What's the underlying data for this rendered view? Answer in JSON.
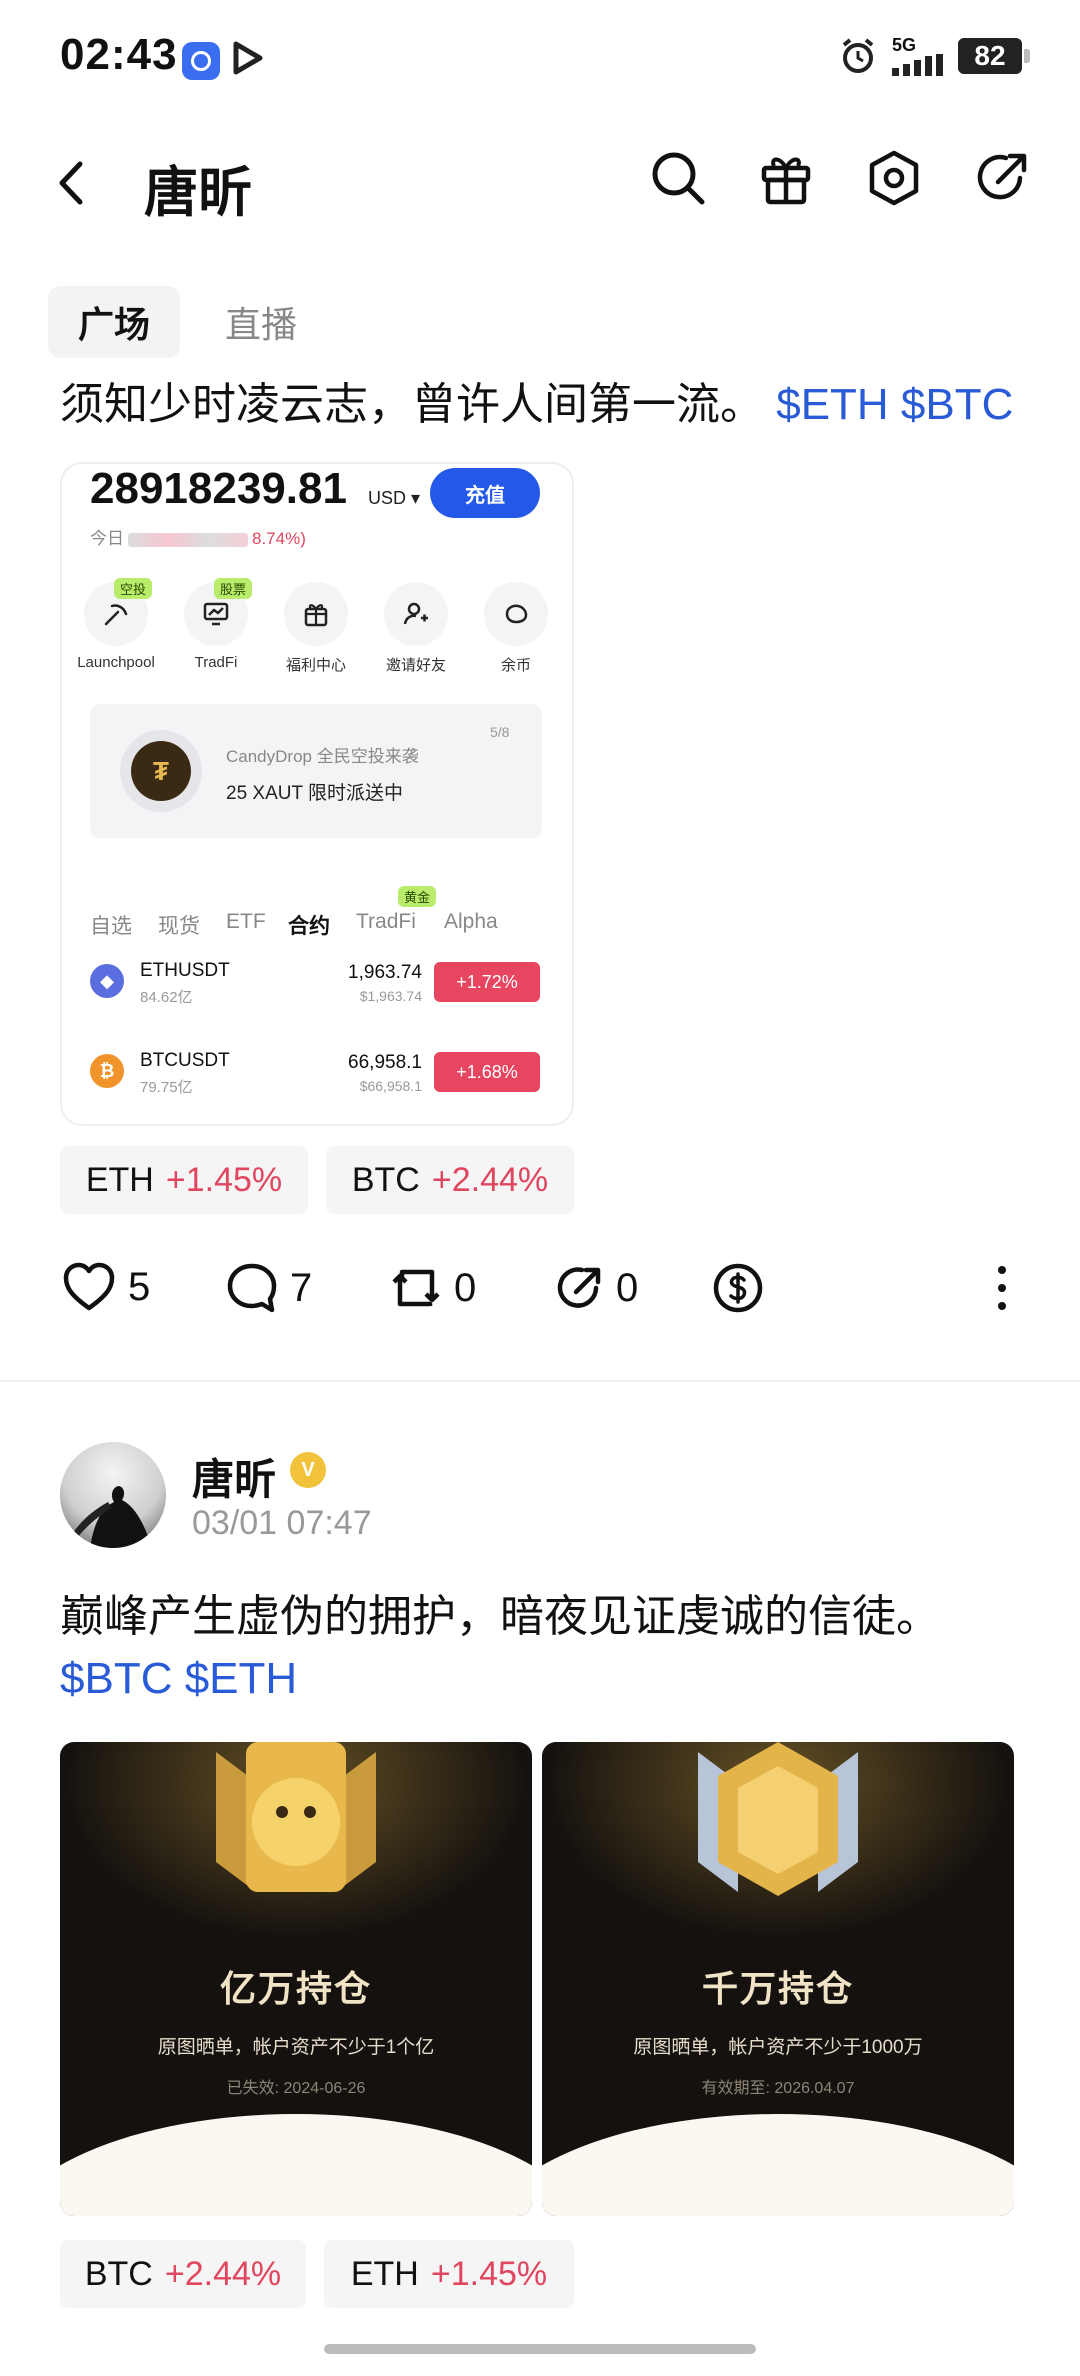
{
  "status_bar": {
    "time": "02:43",
    "network": "5G",
    "battery": "82"
  },
  "header": {
    "title": "唐昕"
  },
  "tabs": [
    {
      "label": "广场"
    },
    {
      "label": "直播"
    }
  ],
  "post1": {
    "text": "须知少时凌云志，曾许人间第一流。",
    "tags": "$ETH $BTC",
    "embedded": {
      "balance": "28918239.81",
      "currency": "USD",
      "deposit_label": "充值",
      "today_label": "今日",
      "today_pct": "8.74%)",
      "quick_items": [
        {
          "label": "Launchpool",
          "badge": "空投"
        },
        {
          "label": "TradFi",
          "badge": "股票"
        },
        {
          "label": "福利中心",
          "badge": ""
        },
        {
          "label": "邀请好友",
          "badge": ""
        },
        {
          "label": "余币",
          "badge": ""
        }
      ],
      "promo": {
        "subtitle": "CandyDrop 全民空投来袭",
        "title": "25 XAUT 限时派送中",
        "page": "5/8"
      },
      "market_tabs": [
        "自选",
        "现货",
        "ETF",
        "合约",
        "TradFi",
        "Alpha"
      ],
      "market_tab_badge": "黄金",
      "rows": [
        {
          "symbol": "ETHUSDT",
          "volume": "84.62亿",
          "price": "1,963.74",
          "price_usd": "$1,963.74",
          "change": "+1.72%"
        },
        {
          "symbol": "BTCUSDT",
          "volume": "79.75亿",
          "price": "66,958.1",
          "price_usd": "$66,958.1",
          "change": "+1.68%"
        }
      ]
    },
    "chips": [
      {
        "name": "ETH",
        "pct": "+1.45%"
      },
      {
        "name": "BTC",
        "pct": "+2.44%"
      }
    ],
    "actions": {
      "likes": "5",
      "comments": "7",
      "reposts": "0",
      "shares": "0"
    }
  },
  "post2": {
    "author": "唐昕",
    "time": "03/01 07:47",
    "text": "巅峰产生虚伪的拥护，暗夜见证虔诚的信徒。",
    "tags": "$BTC $ETH",
    "images": [
      {
        "title": "亿万持仓",
        "subtitle": "原图晒单，帐户资产不少于1个亿",
        "date": "已失效: 2024-06-26"
      },
      {
        "title": "千万持仓",
        "subtitle": "原图晒单，帐户资产不少于1000万",
        "date": "有效期至: 2026.04.07"
      }
    ],
    "chips": [
      {
        "name": "BTC",
        "pct": "+2.44%"
      },
      {
        "name": "ETH",
        "pct": "+1.45%"
      }
    ]
  },
  "colors": {
    "accent": "#2458e8",
    "up": "#e0465f",
    "tag": "#2a5bd7"
  }
}
